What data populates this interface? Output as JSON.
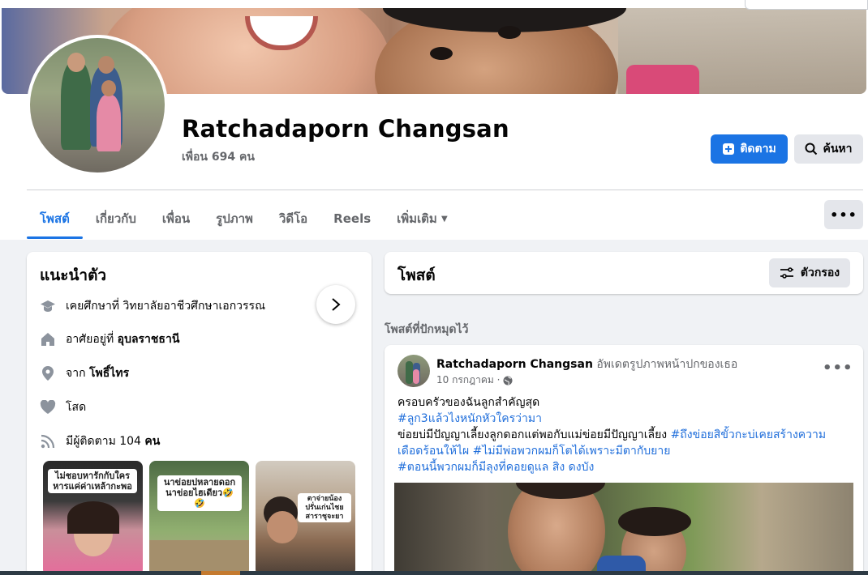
{
  "profile": {
    "name": "Ratchadaporn Changsan",
    "friends": "เพื่อน 694 คน",
    "follow_label": "ติดตาม",
    "search_label": "ค้นหา"
  },
  "tabs": [
    {
      "label": "โพสต์",
      "active": true
    },
    {
      "label": "เกี่ยวกับ",
      "active": false
    },
    {
      "label": "เพื่อน",
      "active": false
    },
    {
      "label": "รูปภาพ",
      "active": false
    },
    {
      "label": "วิดีโอ",
      "active": false
    },
    {
      "label": "Reels",
      "active": false
    },
    {
      "label": "เพิ่มเติม",
      "active": false
    }
  ],
  "more_label": "•••",
  "intro": {
    "title": "แนะนำตัว",
    "items": [
      {
        "icon": "graduation-cap-icon",
        "text": "เคยศึกษาที่ วิทยาลัยอาชีวศึกษาเอกวรรณ",
        "bold": ""
      },
      {
        "icon": "home-icon",
        "text": "อาศัยอยู่ที่ ",
        "bold": "อุบลราชธานี"
      },
      {
        "icon": "location-pin-icon",
        "text": "จาก ",
        "bold": "โพธิ์ไทร"
      },
      {
        "icon": "heart-icon",
        "text": "โสด",
        "bold": ""
      },
      {
        "icon": "rss-icon",
        "text": "มีผู้ติดตาม 104 ",
        "bold": "คน"
      }
    ],
    "thumbs": [
      {
        "caption": "ไม่ชอบหารักกับใคร หารแค่ค่าเหล้ากะพอ"
      },
      {
        "caption": "นาข่อยปหลายดอก นาข่อยไฮเดียว🤣🤣"
      },
      {
        "caption": "ตาจ่ายน้องปรั่นเก่นไชย สาราชุจะยา"
      }
    ]
  },
  "posts": {
    "title": "โพสต์",
    "filter_label": "ตัวกรอง",
    "pinned_label": "โพสต์ที่ปักหมุดไว้",
    "post": {
      "author": "Ratchadaporn Changsan",
      "action": " อัพเดตรูปภาพหน้าปกของเธอ",
      "date": "10 กรกฎาคม ·",
      "line1": "ครอบครัวของฉันลูกสำคัญสุด",
      "line2": "#ลูก3แล้วไงหนักหัวใครว่ามา",
      "line3_plain": "ข่อยบ่มีปัญญาเลี้ยงลูกดอกแต่พอกับแม่ข่อยมีปัญญาเลี้ยง ",
      "line3_tag": "#ถึงข่อยสิขั้วกะบ่เคยสร้างความ",
      "line4_tag1": "เดือดร้อนให้ไผ",
      "line4_tag2": "#ไม่มีพ่อพวกผมก็โตได้เพราะมีตากับยาย",
      "line5": "#ตอนนี้พวกผมก็มีลุงที่คอยดูแล สิง ดงบัง"
    }
  },
  "colors": {
    "accent": "#1b74e4",
    "hashtag": "#216fdb",
    "muted": "#65676b",
    "background": "#f0f2f5"
  }
}
